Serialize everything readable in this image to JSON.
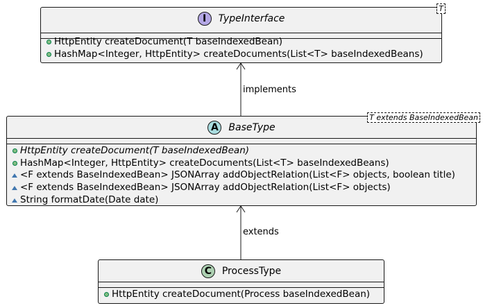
{
  "classes": {
    "type_interface": {
      "stereotype": "I",
      "name": "TypeInterface",
      "type_param": "T",
      "stereotype_color": "#b4a7e5",
      "members": [
        {
          "text": "HttpEntity createDocument(T baseIndexedBean)"
        },
        {
          "text": "HashMap<Integer, HttpEntity> createDocuments(List<T> baseIndexedBeans)"
        }
      ]
    },
    "base_type": {
      "stereotype": "A",
      "name": "BaseType",
      "type_param": "T extends BaseIndexedBean",
      "stereotype_color": "#a9dcdf",
      "members": [
        {
          "text": "HttpEntity createDocument(T baseIndexedBean)"
        },
        {
          "text": "HashMap<Integer, HttpEntity> createDocuments(List<T> baseIndexedBeans)"
        },
        {
          "text": "<F extends BaseIndexedBean> JSONArray addObjectRelation(List<F> objects, boolean title)"
        },
        {
          "text": "<F extends BaseIndexedBean> JSONArray addObjectRelation(List<F> objects)"
        },
        {
          "text": "String formatDate(Date date)"
        }
      ]
    },
    "process_type": {
      "stereotype": "C",
      "name": "ProcessType",
      "stereotype_color": "#add1b2",
      "members": [
        {
          "text": "HttpEntity createDocument(Process baseIndexedBean)"
        }
      ]
    }
  },
  "relations": {
    "implements_label": "implements",
    "extends_label": "extends"
  }
}
